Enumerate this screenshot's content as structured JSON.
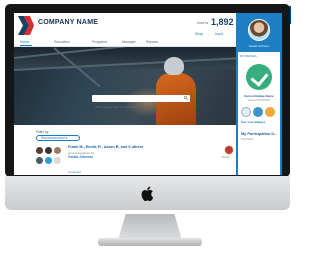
{
  "app": {
    "company_name": "COMPANY NAME",
    "points_label": "POINTS",
    "points_value": "1,892",
    "shop_label": "Shop",
    "input_label": "Input"
  },
  "nav": {
    "items": [
      "Home",
      "Education",
      "Programs",
      "Manager",
      "Reports"
    ]
  },
  "hero": {
    "search_placeholder": "What do you want to recognize?"
  },
  "feed": {
    "filter_label": "Filter by",
    "filter_value": "Recommended ▾",
    "post_title": "Frank M., Emilie R., Aaron B. and 5 others",
    "post_subtitle": "were recognized by",
    "post_author": "Gerald Johnson",
    "comment_label": "Comment",
    "badge_caption": "Badge"
  },
  "sidebar": {
    "profile_name": "Garett Johnson",
    "card_heading": "MY BADGES",
    "badge_title": "Earned Badge Name",
    "badge_subtitle": "Earned 03/10/2019",
    "see_badges": "See Your Badges",
    "participation_title": "My Participation D...",
    "participation_sub": "This Month"
  },
  "colors": {
    "brand_blue": "#1f7fc5",
    "brand_red": "#d62d2d",
    "navy": "#1c3f66",
    "success_green": "#36ad7e"
  },
  "icons": {
    "logo": "x-chevron-logo",
    "apple": "apple-logo-icon",
    "search": "search-icon",
    "check": "check-icon"
  }
}
